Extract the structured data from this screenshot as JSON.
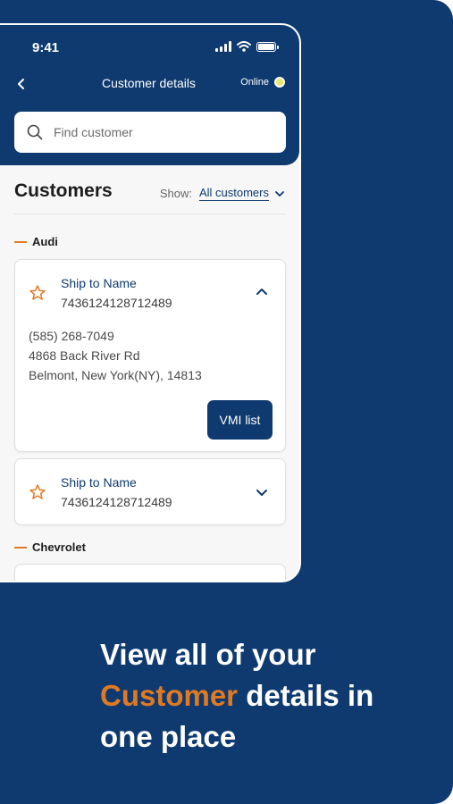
{
  "status_bar": {
    "time": "9:41"
  },
  "header": {
    "title": "Customer details",
    "online_label": "Online"
  },
  "search": {
    "placeholder": "Find customer"
  },
  "customers": {
    "title": "Customers",
    "show_label": "Show:",
    "show_value": "All customers"
  },
  "groups": [
    {
      "name": "Audi",
      "cards": [
        {
          "ship_name": "Ship to Name",
          "ship_id": "7436124128712489",
          "expanded": true,
          "phone": "(585) 268-7049",
          "address_line1": "4868 Back River Rd",
          "address_line2": "Belmont, New York(NY), 14813",
          "action_label": "VMI list"
        },
        {
          "ship_name": "Ship to Name",
          "ship_id": "7436124128712489",
          "expanded": false
        }
      ]
    },
    {
      "name": "Chevrolet"
    }
  ],
  "promo": {
    "line1": "View all of your",
    "accent": "Customer",
    "line2_rest": " details in",
    "line3": "one place"
  },
  "colors": {
    "brand": "#0e3a70",
    "accent": "#e07a22",
    "online_dot": "#e8e86a"
  }
}
